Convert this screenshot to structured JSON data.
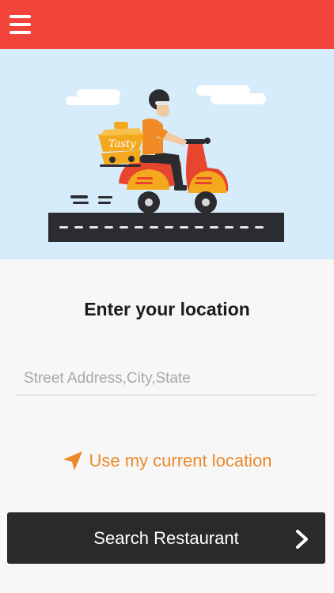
{
  "header": {
    "menu_icon": "hamburger-menu-icon",
    "bar_color": "#f2443a"
  },
  "hero": {
    "brand_text": "Tasty",
    "illustration": "delivery-scooter-illustration"
  },
  "location": {
    "heading": "Enter your location",
    "address_placeholder": "Street Address,City,State",
    "address_value": "",
    "current_location_label": "Use my current location",
    "current_location_icon": "location-arrow-icon",
    "accent_color": "#ec8a2a"
  },
  "search": {
    "button_label": "Search Restaurant",
    "button_icon": "chevron-right-icon"
  }
}
